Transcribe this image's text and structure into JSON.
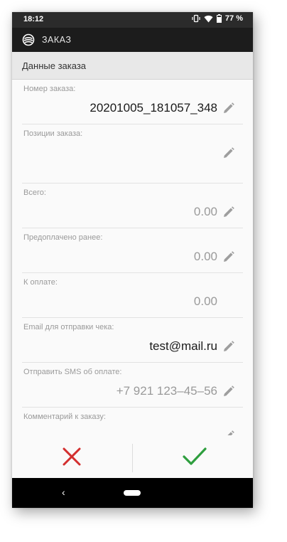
{
  "status_bar": {
    "time": "18:12",
    "battery": "77 %",
    "icons": [
      "vibrate-icon",
      "wifi-icon",
      "battery-icon"
    ]
  },
  "app_bar": {
    "title": "ЗАКАЗ",
    "logo_icon": "sberbank-logo-icon"
  },
  "section": {
    "title": "Данные заказа"
  },
  "fields": {
    "order_number": {
      "label": "Номер заказа:",
      "value": "20201005_181057_348"
    },
    "positions": {
      "label": "Позиции заказа:",
      "value": ""
    },
    "total": {
      "label": "Всего:",
      "value": "0.00"
    },
    "prepaid": {
      "label": "Предоплачено ранее:",
      "value": "0.00"
    },
    "to_pay": {
      "label": "К оплате:",
      "value": "0.00"
    },
    "email": {
      "label": "Email для отправки чека:",
      "value": "test@mail.ru"
    },
    "sms": {
      "label": "Отправить SMS об оплате:",
      "value": "+7 921 123–45–56"
    },
    "comment": {
      "label": "Комментарий к заказу:",
      "value": ""
    }
  },
  "actions": {
    "cancel_icon": "close-icon",
    "cancel_color": "#d32f2f",
    "confirm_icon": "check-icon",
    "confirm_color": "#2e9e3e"
  },
  "nav_bar": {
    "back_glyph": "‹"
  }
}
